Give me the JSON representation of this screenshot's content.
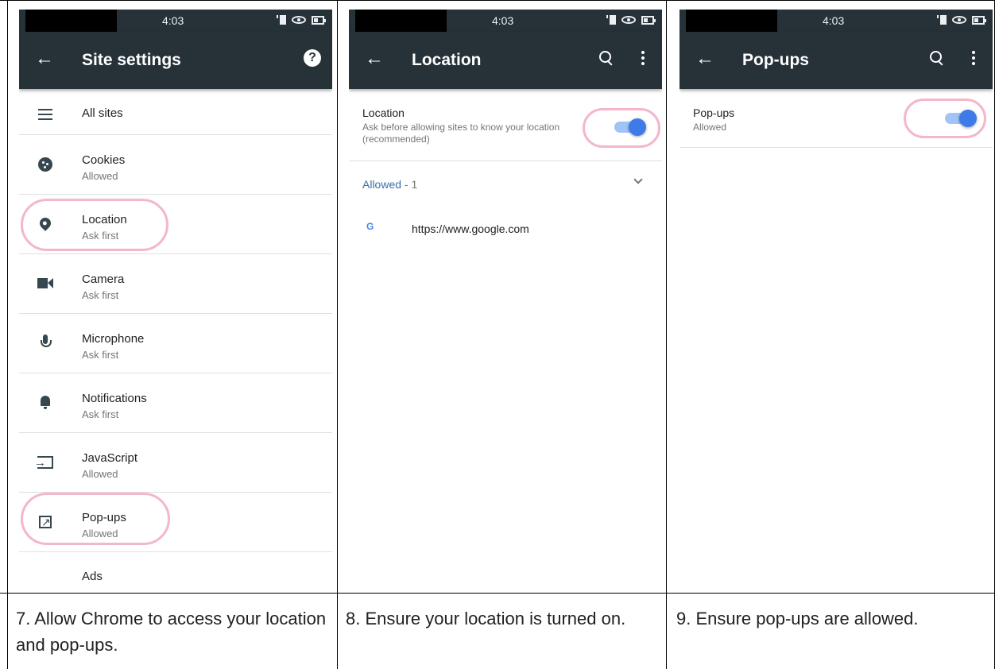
{
  "status": {
    "time": "4:03"
  },
  "panel1": {
    "title": "Site settings",
    "help_glyph": "?",
    "items": [
      {
        "label": "All sites",
        "sub": ""
      },
      {
        "label": "Cookies",
        "sub": "Allowed"
      },
      {
        "label": "Location",
        "sub": "Ask first"
      },
      {
        "label": "Camera",
        "sub": "Ask first"
      },
      {
        "label": "Microphone",
        "sub": "Ask first"
      },
      {
        "label": "Notifications",
        "sub": "Ask first"
      },
      {
        "label": "JavaScript",
        "sub": "Allowed"
      },
      {
        "label": "Pop-ups",
        "sub": "Allowed"
      },
      {
        "label": "Ads",
        "sub": ""
      }
    ]
  },
  "panel2": {
    "title": "Location",
    "toggle_title": "Location",
    "toggle_sub": "Ask before allowing sites to know your location (recommended)",
    "toggle_on": true,
    "allowed_label": "Allowed",
    "allowed_count": " - 1",
    "site_icon": "G",
    "site_url": "https://www.google.com"
  },
  "panel3": {
    "title": "Pop-ups",
    "toggle_title": "Pop-ups",
    "toggle_sub": "Allowed",
    "toggle_on": true
  },
  "captions": [
    "7. Allow Chrome to access your location and pop-ups.",
    "8. Ensure your location is turned on.",
    "9. Ensure pop-ups are allowed."
  ],
  "colors": {
    "toolbar": "#263238",
    "highlight": "#f4b6cb",
    "switch_knob": "#3f7be8",
    "link_blue": "#3b6ea8"
  }
}
